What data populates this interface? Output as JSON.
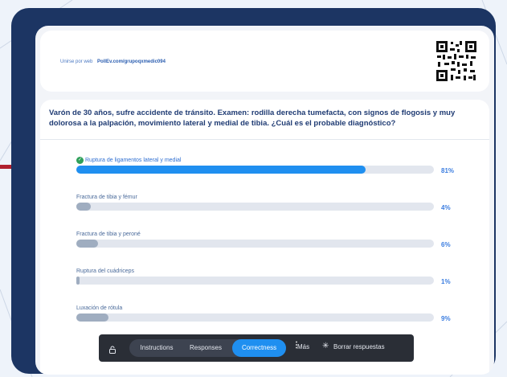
{
  "join": {
    "label": "Unirse por web",
    "url": "PollEv.com/grupoqxmedic094"
  },
  "question": "Varón de 30 años, sufre accidente de tránsito. Examen: rodilla derecha tumefacta, con signos de flogosis y muy dolorosa a la palpación, movimiento lateral y medial de tibia. ¿Cuál es el probable diagnóstico?",
  "options": [
    {
      "label": "Ruptura de ligamentos lateral y medial",
      "percent_text": "81%",
      "value": 81,
      "correct": true
    },
    {
      "label": "Fractura de tibia y fémur",
      "percent_text": "4%",
      "value": 4,
      "correct": false
    },
    {
      "label": "Fractura de tibia y peroné",
      "percent_text": "6%",
      "value": 6,
      "correct": false
    },
    {
      "label": "Ruptura del cuádriceps",
      "percent_text": "1%",
      "value": 1,
      "correct": false
    },
    {
      "label": "Luxación de rótula",
      "percent_text": "9%",
      "value": 9,
      "correct": false
    }
  ],
  "toolbar": {
    "tabs": [
      "Instructions",
      "Responses",
      "Correctness"
    ],
    "active_tab": "Correctness",
    "more_label": "Más",
    "clear_label": "Borrar respuestas"
  },
  "colors": {
    "frame": "#1c3563",
    "correct_bar": "#1f8ff0",
    "other_bar": "#9fadc0",
    "check": "#2fa05a",
    "pointer": "#b0202e"
  }
}
